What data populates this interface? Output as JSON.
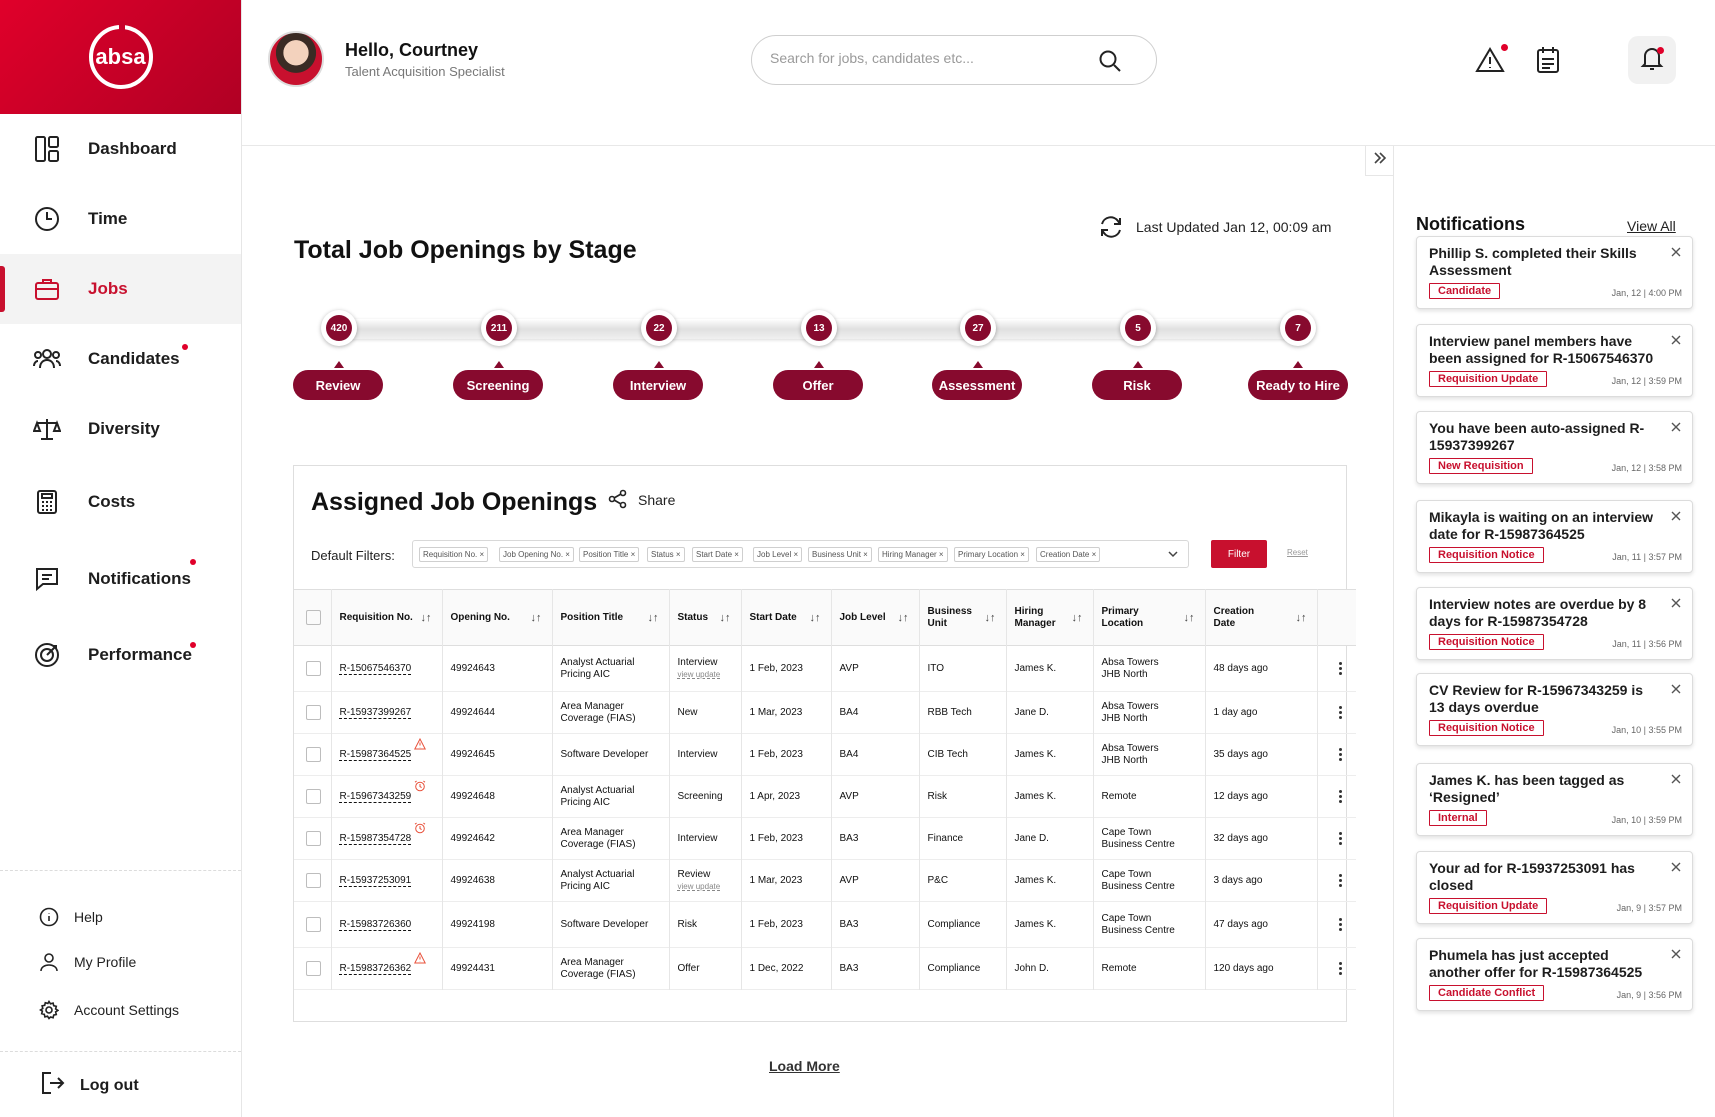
{
  "brand": {
    "logo_text": "absa",
    "primary_color": "#c8102e",
    "stage_color": "#870a2e"
  },
  "sidebar": {
    "items": [
      {
        "label": "Dashboard",
        "icon": "dashboard-icon",
        "active": false,
        "dot": false
      },
      {
        "label": "Time",
        "icon": "clock-icon",
        "active": false,
        "dot": false
      },
      {
        "label": "Jobs",
        "icon": "briefcase-icon",
        "active": true,
        "dot": false
      },
      {
        "label": "Candidates",
        "icon": "people-icon",
        "active": false,
        "dot": true
      },
      {
        "label": "Diversity",
        "icon": "scales-icon",
        "active": false,
        "dot": false
      },
      {
        "label": "Costs",
        "icon": "calculator-icon",
        "active": false,
        "dot": false
      },
      {
        "label": "Notifications",
        "icon": "message-icon",
        "active": false,
        "dot": true
      },
      {
        "label": "Performance",
        "icon": "target-icon",
        "active": false,
        "dot": true
      }
    ],
    "help": "Help",
    "my_profile": "My Profile",
    "account_settings": "Account Settings",
    "logout": "Log out"
  },
  "header": {
    "greeting": "Hello, Courtney",
    "role": "Talent Acquisition Specialist",
    "search_placeholder": "Search for jobs, candidates etc..."
  },
  "stages": {
    "title": "Total Job Openings by Stage",
    "last_updated": "Last Updated Jan 12, 00:09 am",
    "items": [
      {
        "label": "Review",
        "count": "420"
      },
      {
        "label": "Screening",
        "count": "211"
      },
      {
        "label": "Interview",
        "count": "22"
      },
      {
        "label": "Offer",
        "count": "13"
      },
      {
        "label": "Assessment",
        "count": "27"
      },
      {
        "label": "Risk",
        "count": "5"
      },
      {
        "label": "Ready to Hire",
        "count": "7"
      }
    ]
  },
  "jobs": {
    "title": "Assigned Job Openings",
    "share": "Share",
    "filters_label": "Default Filters:",
    "filter_chips": [
      "Requisition No.",
      "Job Opening No.",
      "Position Title",
      "Status",
      "Start Date",
      "Job Level",
      "Business Unit",
      "Hiring Manager",
      "Primary Location",
      "Creation Date"
    ],
    "filter_button": "Filter",
    "reset": "Reset",
    "columns": [
      [
        "Requisition No."
      ],
      [
        "Opening No."
      ],
      [
        "Position Title"
      ],
      [
        "Status"
      ],
      [
        "Start Date"
      ],
      [
        "Job Level"
      ],
      [
        "Business",
        "Unit"
      ],
      [
        "Hiring",
        "Manager"
      ],
      [
        "Primary",
        "Location"
      ],
      [
        "Creation",
        "Date"
      ]
    ],
    "rows": [
      {
        "req": "R-15067546370",
        "flag": "",
        "opening": "49924643",
        "title": [
          "Analyst Actuarial",
          "Pricing AIC"
        ],
        "status": "Interview",
        "view_update": "view update",
        "start": "1 Feb, 2023",
        "level": "AVP",
        "unit": "ITO",
        "manager": "James K.",
        "location": [
          "Absa Towers",
          "JHB North"
        ],
        "created": "48 days ago"
      },
      {
        "req": "R-15937399267",
        "flag": "",
        "opening": "49924644",
        "title": [
          "Area Manager",
          "Coverage (FIAS)"
        ],
        "status": "New",
        "view_update": "",
        "start": "1 Mar, 2023",
        "level": "BA4",
        "unit": "RBB Tech",
        "manager": "Jane D.",
        "location": [
          "Absa Towers",
          "JHB North"
        ],
        "created": "1 day ago"
      },
      {
        "req": "R-15987364525",
        "flag": "warning-icon",
        "opening": "49924645",
        "title": [
          "Software Developer"
        ],
        "status": "Interview",
        "view_update": "",
        "start": "1 Feb, 2023",
        "level": "BA4",
        "unit": "CIB Tech",
        "manager": "James K.",
        "location": [
          "Absa Towers",
          "JHB North"
        ],
        "created": "35 days ago"
      },
      {
        "req": "R-15967343259",
        "flag": "alarm-icon",
        "opening": "49924648",
        "title": [
          "Analyst Actuarial",
          "Pricing AIC"
        ],
        "status": "Screening",
        "view_update": "",
        "start": "1 Apr, 2023",
        "level": "AVP",
        "unit": "Risk",
        "manager": "James K.",
        "location": [
          "Remote"
        ],
        "created": "12 days ago"
      },
      {
        "req": "R-15987354728",
        "flag": "alarm-icon",
        "opening": "49924642",
        "title": [
          "Area Manager",
          "Coverage (FIAS)"
        ],
        "status": "Interview",
        "view_update": "",
        "start": "1 Feb, 2023",
        "level": "BA3",
        "unit": "Finance",
        "manager": "Jane D.",
        "location": [
          "Cape Town",
          "Business Centre"
        ],
        "created": "32 days ago"
      },
      {
        "req": "R-15937253091",
        "flag": "",
        "opening": "49924638",
        "title": [
          "Analyst Actuarial",
          "Pricing AIC"
        ],
        "status": "Review",
        "view_update": "view update",
        "start": "1 Mar, 2023",
        "level": "AVP",
        "unit": "P&C",
        "manager": "James K.",
        "location": [
          "Cape Town",
          "Business Centre"
        ],
        "created": "3 days ago"
      },
      {
        "req": "R-15983726360",
        "flag": "",
        "opening": "49924198",
        "title": [
          "Software Developer"
        ],
        "status": "Risk",
        "view_update": "",
        "start": "1 Feb, 2023",
        "level": "BA3",
        "unit": "Compliance",
        "manager": "James K.",
        "location": [
          "Cape Town",
          "Business Centre"
        ],
        "created": "47 days ago"
      },
      {
        "req": "R-15983726362",
        "flag": "warning-icon",
        "opening": "49924431",
        "title": [
          "Area Manager",
          "Coverage (FIAS)"
        ],
        "status": "Offer",
        "view_update": "",
        "start": "1 Dec, 2022",
        "level": "BA3",
        "unit": "Compliance",
        "manager": "John D.",
        "location": [
          "Remote"
        ],
        "created": "120 days ago"
      }
    ],
    "load_more": "Load More"
  },
  "notifications": {
    "title": "Notifications",
    "view_all": "View All",
    "items": [
      {
        "text": "Phillip S. completed their Skills Assessment",
        "tag": "Candidate",
        "time": "Jan, 12 | 4:00 PM"
      },
      {
        "text": "Interview panel members have been assigned for R-15067546370",
        "tag": "Requisition Update",
        "time": "Jan, 12 | 3:59 PM"
      },
      {
        "text": "You have been auto-assigned R-15937399267",
        "tag": "New Requisition",
        "time": "Jan, 12 | 3:58 PM"
      },
      {
        "text": "Mikayla is waiting on an interview date for R-15987364525",
        "tag": "Requisition Notice",
        "time": "Jan, 11 | 3:57 PM"
      },
      {
        "text": "Interview notes are overdue by 8 days for R-15987354728",
        "tag": "Requisition Notice",
        "time": "Jan, 11 | 3:56 PM"
      },
      {
        "text": "CV Review for R-15967343259 is 13 days overdue",
        "tag": "Requisition Notice",
        "time": "Jan, 10 | 3:55 PM"
      },
      {
        "text": "James K. has been tagged as ‘Resigned’",
        "tag": "Internal",
        "time": "Jan, 10 | 3:59 PM"
      },
      {
        "text": "Your ad for R-15937253091 has closed",
        "tag": "Requisition Update",
        "time": "Jan, 9 | 3:57 PM"
      },
      {
        "text": "Phumela has just accepted another offer for R-15987364525",
        "tag": "Candidate Conflict",
        "time": "Jan, 9 | 3:56 PM"
      }
    ]
  }
}
